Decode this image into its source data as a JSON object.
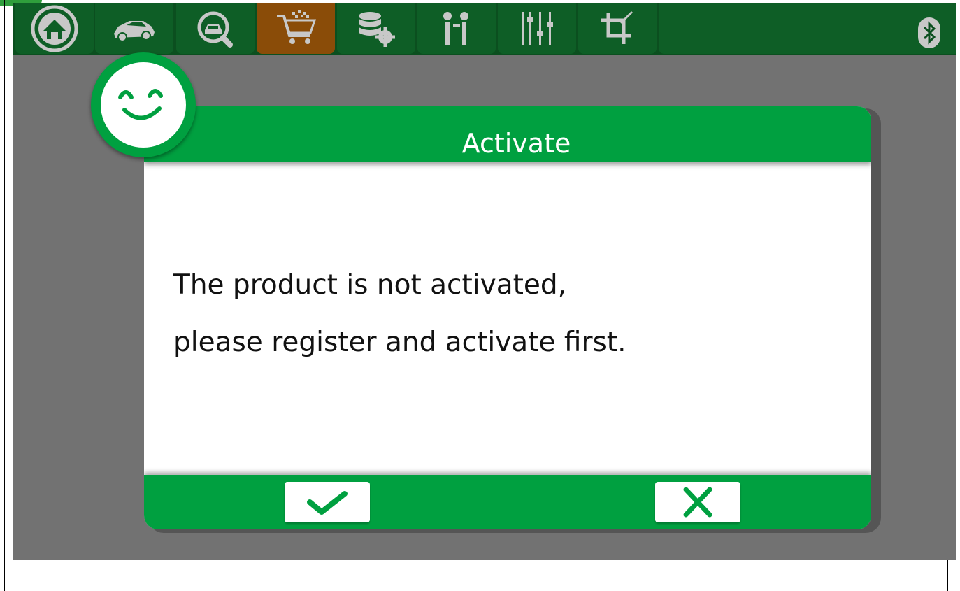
{
  "toolbar": {
    "tabs": [
      {
        "icon": "home-icon",
        "active": false
      },
      {
        "icon": "car-icon",
        "active": false
      },
      {
        "icon": "car-search-icon",
        "active": false
      },
      {
        "icon": "shopping-cart-icon",
        "active": true
      },
      {
        "icon": "database-settings-icon",
        "active": false
      },
      {
        "icon": "people-icon",
        "active": false
      },
      {
        "icon": "sliders-icon",
        "active": false
      },
      {
        "icon": "crop-icon",
        "active": false
      }
    ],
    "status_icon": "bluetooth-icon"
  },
  "dialog": {
    "title": "Activate",
    "message_line_1": "The product is not activated,",
    "message_line_2": "please register and activate first.",
    "confirm_icon": "checkmark-icon",
    "cancel_icon": "close-icon",
    "badge_icon": "smiley-icon"
  },
  "colors": {
    "toolbar_bg": "#0b4f1f",
    "tab_bg": "#0e5e26",
    "tab_active_bg": "#8a4c08",
    "accent_green": "#00a040",
    "overlay_gray": "#727272"
  }
}
